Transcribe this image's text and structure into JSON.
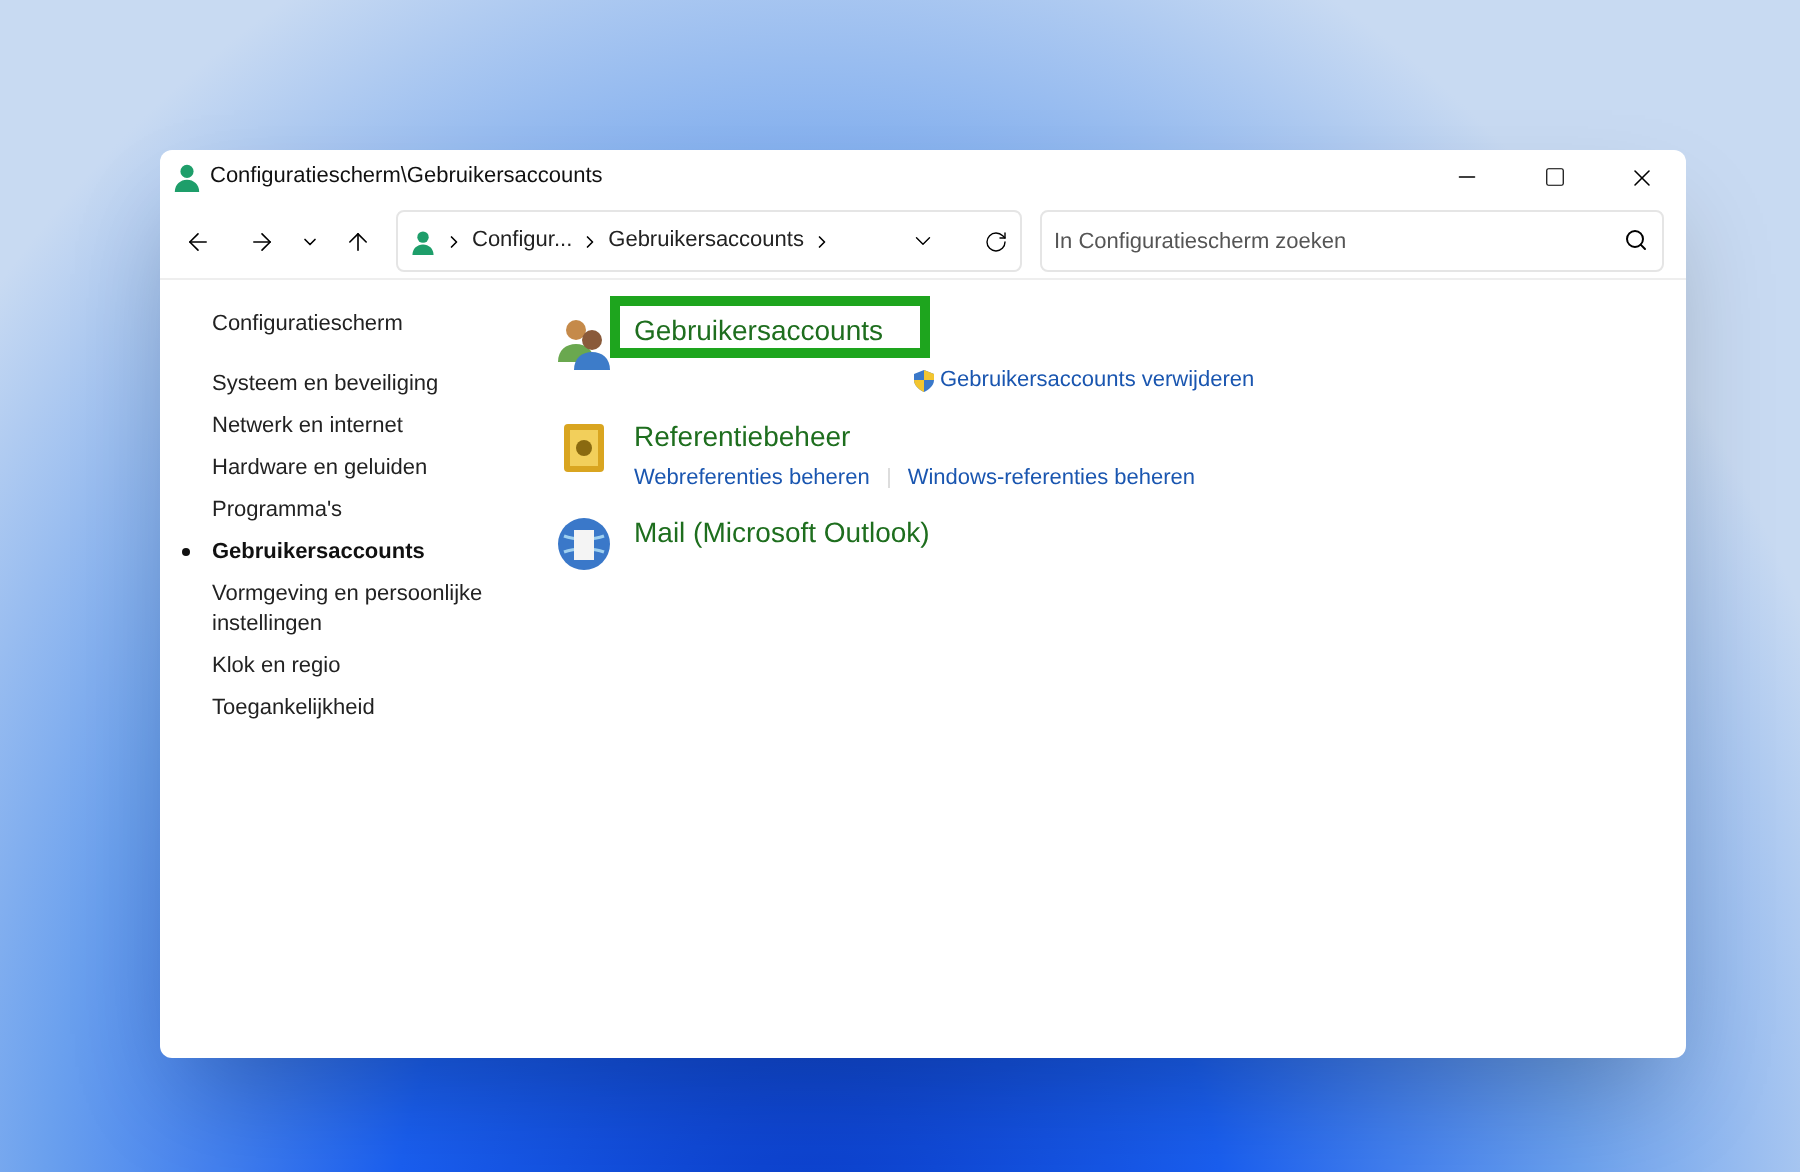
{
  "window": {
    "title": "Configuratiescherm\\Gebruikersaccounts"
  },
  "address_bar": {
    "segments": [
      "Configur...",
      "Gebruikersaccounts"
    ]
  },
  "search": {
    "placeholder": "In Configuratiescherm zoeken"
  },
  "sidebar": {
    "home": "Configuratiescherm",
    "items": [
      {
        "label": "Systeem en beveiliging",
        "selected": false
      },
      {
        "label": "Netwerk en internet",
        "selected": false
      },
      {
        "label": "Hardware en geluiden",
        "selected": false
      },
      {
        "label": "Programma's",
        "selected": false
      },
      {
        "label": "Gebruikersaccounts",
        "selected": true
      },
      {
        "label": "Vormgeving en persoonlijke instellingen",
        "selected": false
      },
      {
        "label": "Klok en regio",
        "selected": false
      },
      {
        "label": "Toegankelijkheid",
        "selected": false
      }
    ]
  },
  "categories": [
    {
      "kind": "users",
      "title": "Gebruikersaccounts",
      "highlighted": true,
      "links": [
        {
          "label": "Gebruikersaccounts verwijderen",
          "shield": true
        }
      ]
    },
    {
      "kind": "vault",
      "title": "Referentiebeheer",
      "highlighted": false,
      "links": [
        {
          "label": "Webreferenties beheren",
          "shield": false
        },
        {
          "label": "Windows-referenties beheren",
          "shield": false
        }
      ]
    },
    {
      "kind": "mail",
      "title": "Mail (Microsoft Outlook)",
      "highlighted": false
    }
  ]
}
